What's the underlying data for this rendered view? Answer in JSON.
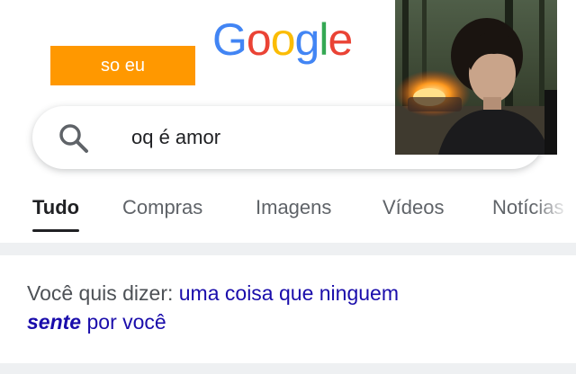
{
  "logo": {
    "letters": [
      "G",
      "o",
      "o",
      "g",
      "l",
      "e"
    ],
    "colors": [
      "#4285F4",
      "#EA4335",
      "#FBBC05",
      "#4285F4",
      "#34A853",
      "#EA4335"
    ]
  },
  "meme_label": "so eu",
  "search": {
    "icon": "search-icon",
    "query": "oq é amor"
  },
  "photo": {
    "icon": "person-photo"
  },
  "tabs": [
    {
      "label": "Tudo",
      "active": true
    },
    {
      "label": "Compras"
    },
    {
      "label": "Imagens"
    },
    {
      "label": "Vídeos"
    },
    {
      "label": "Notícias"
    }
  ],
  "suggestion": {
    "prefix": "Você quis dizer:",
    "link": "uma coisa que ninguem",
    "emphasis": "sente",
    "suffix": "por você"
  },
  "colors": {
    "accent_orange": "#FF9800",
    "link_blue": "#1a0dab",
    "text_gray": "#5f6368"
  }
}
